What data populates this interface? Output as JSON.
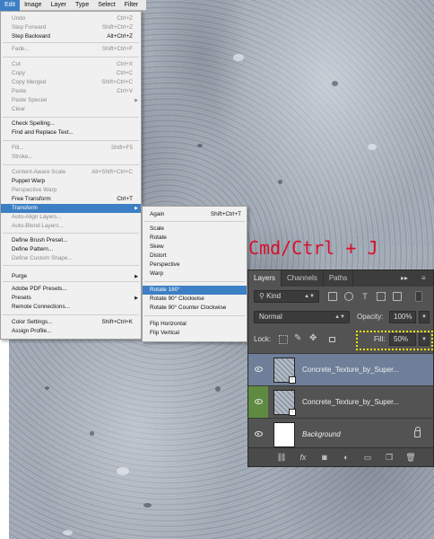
{
  "menubar": [
    "Edit",
    "Image",
    "Layer",
    "Type",
    "Select",
    "Filter"
  ],
  "edit_menu": [
    {
      "label": "Undo",
      "shortcut": "Ctrl+Z",
      "disabled": true
    },
    {
      "label": "Step Forward",
      "shortcut": "Shift+Ctrl+Z",
      "disabled": true
    },
    {
      "label": "Step Backward",
      "shortcut": "Alt+Ctrl+Z",
      "disabled": false
    },
    {
      "label": "Fade...",
      "shortcut": "Shift+Ctrl+F",
      "disabled": true
    },
    {
      "label": "Cut",
      "shortcut": "Ctrl+X",
      "disabled": true
    },
    {
      "label": "Copy",
      "shortcut": "Ctrl+C",
      "disabled": true
    },
    {
      "label": "Copy Merged",
      "shortcut": "Shift+Ctrl+C",
      "disabled": true
    },
    {
      "label": "Paste",
      "shortcut": "Ctrl+V",
      "disabled": true
    },
    {
      "label": "Paste Special",
      "shortcut": "",
      "disabled": true
    },
    {
      "label": "Clear",
      "shortcut": "",
      "disabled": true
    },
    {
      "label": "Check Spelling...",
      "shortcut": "",
      "disabled": false
    },
    {
      "label": "Find and Replace Text...",
      "shortcut": "",
      "disabled": false
    },
    {
      "label": "Fill...",
      "shortcut": "Shift+F5",
      "disabled": true
    },
    {
      "label": "Stroke...",
      "shortcut": "",
      "disabled": true
    },
    {
      "label": "Content-Aware Scale",
      "shortcut": "Alt+Shift+Ctrl+C",
      "disabled": true
    },
    {
      "label": "Puppet Warp",
      "shortcut": "",
      "disabled": false
    },
    {
      "label": "Perspective Warp",
      "shortcut": "",
      "disabled": true
    },
    {
      "label": "Free Transform",
      "shortcut": "Ctrl+T",
      "disabled": false
    },
    {
      "label": "Transform",
      "shortcut": "",
      "disabled": false
    },
    {
      "label": "Auto-Align Layers...",
      "shortcut": "",
      "disabled": true
    },
    {
      "label": "Auto-Blend Layers...",
      "shortcut": "",
      "disabled": true
    },
    {
      "label": "Define Brush Preset...",
      "shortcut": "",
      "disabled": false
    },
    {
      "label": "Define Pattern...",
      "shortcut": "",
      "disabled": false
    },
    {
      "label": "Define Custom Shape...",
      "shortcut": "",
      "disabled": true
    },
    {
      "label": "Purge",
      "shortcut": "",
      "disabled": false
    },
    {
      "label": "Adobe PDF Presets...",
      "shortcut": "",
      "disabled": false
    },
    {
      "label": "Presets",
      "shortcut": "",
      "disabled": false
    },
    {
      "label": "Remote Connections...",
      "shortcut": "",
      "disabled": false
    },
    {
      "label": "Color Settings...",
      "shortcut": "Shift+Ctrl+K",
      "disabled": false
    },
    {
      "label": "Assign Profile...",
      "shortcut": "",
      "disabled": false
    }
  ],
  "transform_submenu": [
    {
      "label": "Again",
      "shortcut": "Shift+Ctrl+T"
    },
    {
      "label": "Scale",
      "shortcut": ""
    },
    {
      "label": "Rotate",
      "shortcut": ""
    },
    {
      "label": "Skew",
      "shortcut": ""
    },
    {
      "label": "Distort",
      "shortcut": ""
    },
    {
      "label": "Perspective",
      "shortcut": ""
    },
    {
      "label": "Warp",
      "shortcut": ""
    },
    {
      "label": "Rotate 180°",
      "shortcut": ""
    },
    {
      "label": "Rotate 90° Clockwise",
      "shortcut": ""
    },
    {
      "label": "Rotate 90° Counter Clockwise",
      "shortcut": ""
    },
    {
      "label": "Flip Horizontal",
      "shortcut": ""
    },
    {
      "label": "Flip Vertical",
      "shortcut": ""
    }
  ],
  "caption": "Cmd/Ctrl + J",
  "layers_panel": {
    "tabs": [
      "Layers",
      "Channels",
      "Paths"
    ],
    "tab_controls": {
      "collapse": "▸▸",
      "menu": "≡"
    },
    "filter_kind": "Kind",
    "blend_mode": "Normal",
    "opacity_label": "Opacity:",
    "opacity_value": "100%",
    "lock_label": "Lock:",
    "fill_label": "Fill:",
    "fill_value": "50%",
    "layers": [
      {
        "name": "Concrete_Texture_by_Super...",
        "selected": true,
        "italic": false
      },
      {
        "name": "Concrete_Texture_by_Super...",
        "selected": false,
        "italic": false
      },
      {
        "name": "Background",
        "selected": false,
        "italic": true
      }
    ],
    "footer_icons": [
      "link-icon",
      "fx-icon",
      "mask-icon",
      "adjustment-icon",
      "folder-icon",
      "new-layer-icon",
      "trash-icon"
    ],
    "footer_glyphs": {
      "link": "⛓",
      "fx": "fx",
      "mask": "◙",
      "adjustment": "◐",
      "folder": "▭",
      "new_layer": "❐",
      "trash": "🗑"
    },
    "colors": {
      "accent": "#3c7fc4",
      "panel": "#535353",
      "highlight_box": "#f2e400",
      "caption": "#d8102c",
      "selected_layer": "#6f7f99",
      "eye_active": "#5e8a41"
    }
  }
}
